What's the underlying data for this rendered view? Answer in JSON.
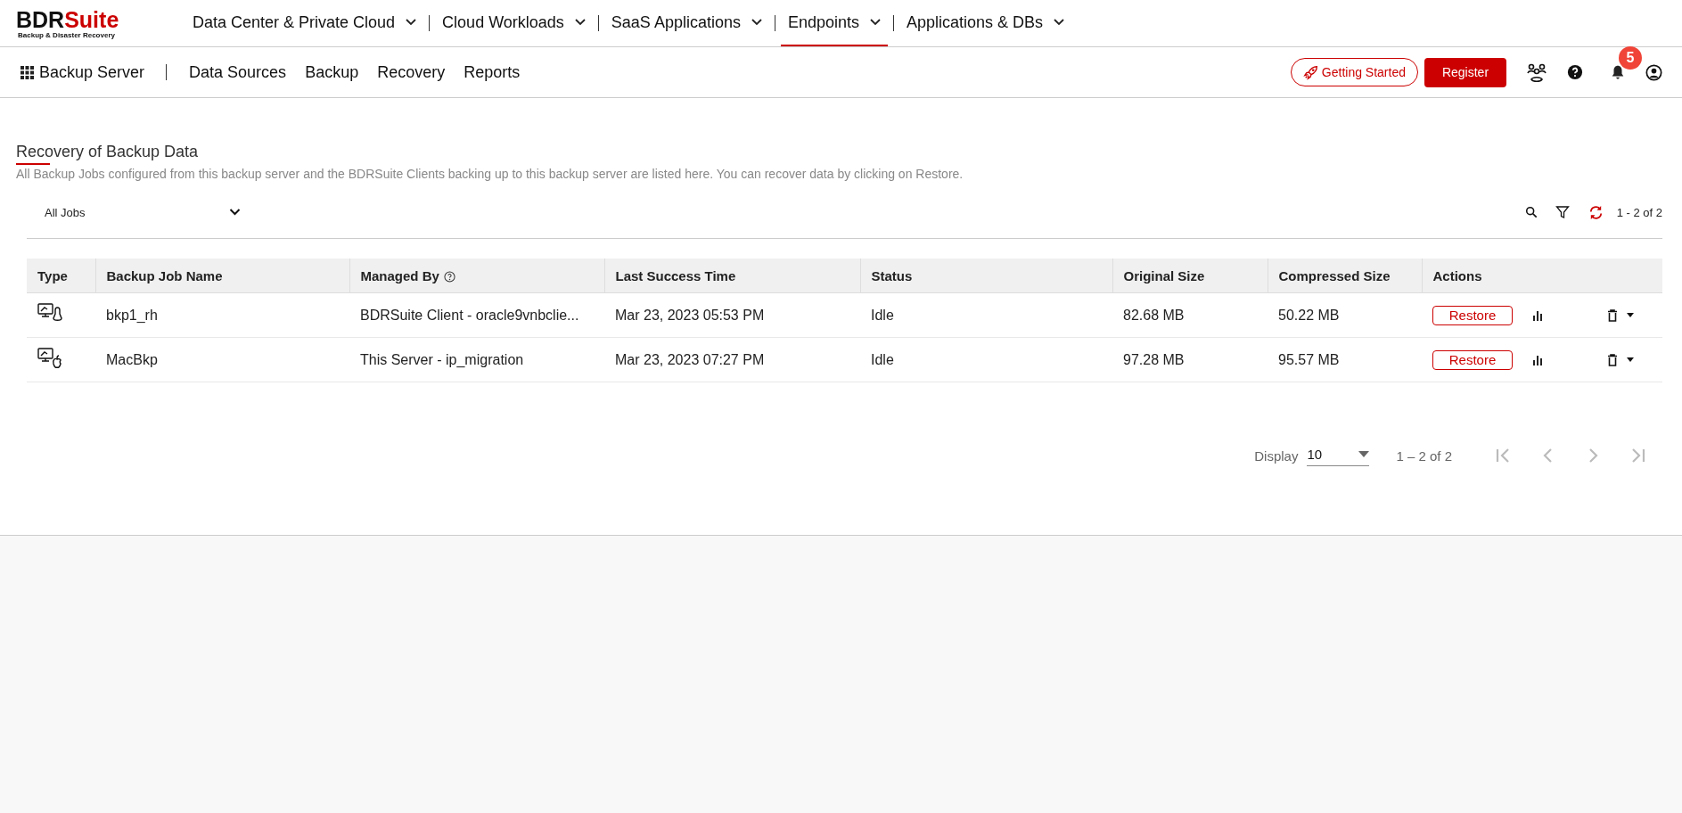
{
  "logo": {
    "brand_dark": "BDR",
    "brand_accent": "Suite",
    "tagline": "Backup & Disaster Recovery"
  },
  "top_nav": [
    {
      "label": "Data Center & Private Cloud",
      "selected": false
    },
    {
      "label": "Cloud Workloads",
      "selected": false
    },
    {
      "label": "SaaS Applications",
      "selected": false
    },
    {
      "label": "Endpoints",
      "selected": true
    },
    {
      "label": "Applications & DBs",
      "selected": false
    }
  ],
  "sub_nav": {
    "home": "Backup Server",
    "items": [
      "Data Sources",
      "Backup",
      "Recovery",
      "Reports"
    ]
  },
  "header_actions": {
    "getting_started": "Getting Started",
    "register": "Register",
    "notifications": "5"
  },
  "page": {
    "title": "Recovery of Backup Data",
    "description": "All Backup Jobs configured from this backup server and the BDRSuite Clients backing up to this backup server are listed here. You can recover data by clicking on Restore."
  },
  "filter": {
    "value": "All Jobs"
  },
  "range": "1 - 2 of 2",
  "table": {
    "columns": [
      "Type",
      "Backup Job Name",
      "Managed By",
      "Last Success Time",
      "Status",
      "Original Size",
      "Compressed Size",
      "Actions"
    ],
    "rows": [
      {
        "kind": "linux",
        "name": "bkp1_rh",
        "managed_by": "BDRSuite Client - oracle9vnbclie...",
        "last_success": "Mar 23, 2023 05:53 PM",
        "status": "Idle",
        "original_size": "82.68 MB",
        "compressed_size": "50.22 MB",
        "action": "Restore"
      },
      {
        "kind": "mac",
        "name": "MacBkp",
        "managed_by": "This Server - ip_migration",
        "last_success": "Mar 23, 2023 07:27 PM",
        "status": "Idle",
        "original_size": "97.28 MB",
        "compressed_size": "95.57 MB",
        "action": "Restore"
      }
    ]
  },
  "pager": {
    "label": "Display",
    "page_size": "10",
    "range": "1 – 2 of 2"
  }
}
